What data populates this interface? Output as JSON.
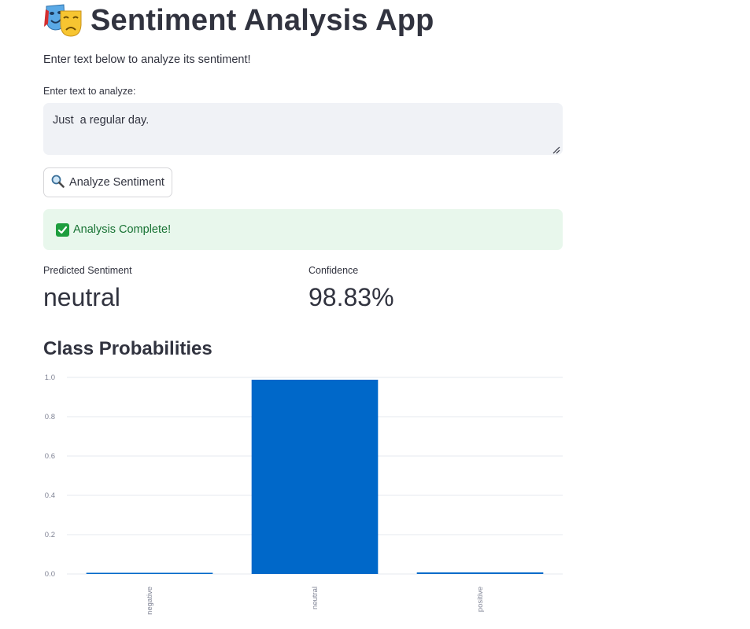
{
  "app": {
    "title": "Sentiment Analysis App",
    "title_icon": "performing-arts-masks-icon",
    "subtitle": "Enter text below to analyze its sentiment!"
  },
  "input": {
    "label": "Enter text to analyze:",
    "value": "Just  a regular day."
  },
  "analyze_button": {
    "icon": "magnifier-icon",
    "label": "Analyze Sentiment"
  },
  "status": {
    "icon": "checkmark-icon",
    "message": "Analysis Complete!"
  },
  "metrics": {
    "sentiment_label": "Predicted Sentiment",
    "sentiment_value": "neutral",
    "confidence_label": "Confidence",
    "confidence_value": "98.83%"
  },
  "section": {
    "probabilities_title": "Class Probabilities"
  },
  "colors": {
    "bar": "#0068c9",
    "success_bg": "#e8f7ec",
    "success_text": "#177233",
    "input_bg": "#f0f2f6",
    "text": "#31333f"
  },
  "chart_data": {
    "type": "bar",
    "categories": [
      "negative",
      "neutral",
      "positive"
    ],
    "values": [
      0.004,
      0.9883,
      0.0077
    ],
    "title": "",
    "xlabel": "",
    "ylabel": "",
    "ylim": [
      0,
      1.0
    ],
    "yticks": [
      "0.0",
      "0.2",
      "0.4",
      "0.6",
      "0.8",
      "1.0"
    ],
    "grid": true
  }
}
